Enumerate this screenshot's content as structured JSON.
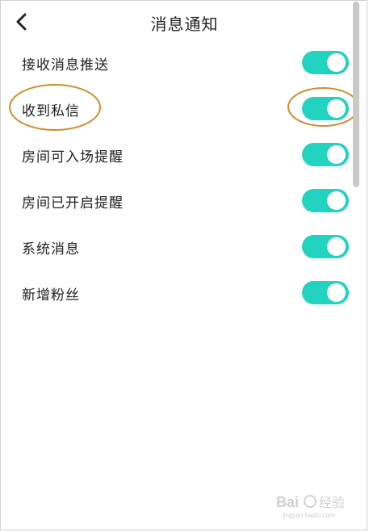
{
  "header": {
    "title": "消息通知",
    "back_icon": "chevron-left-icon"
  },
  "settings": [
    {
      "label": "接收消息推送",
      "enabled": true
    },
    {
      "label": "收到私信",
      "enabled": true
    },
    {
      "label": "房间可入场提醒",
      "enabled": true
    },
    {
      "label": "房间已开启提醒",
      "enabled": true
    },
    {
      "label": "系统消息",
      "enabled": true
    },
    {
      "label": "新增粉丝",
      "enabled": true
    }
  ],
  "colors": {
    "toggle_on": "#22d3c0",
    "highlight": "#d08a2a"
  },
  "watermark": {
    "brand": "Bai经验",
    "url": "jingyan.baidu.com"
  }
}
